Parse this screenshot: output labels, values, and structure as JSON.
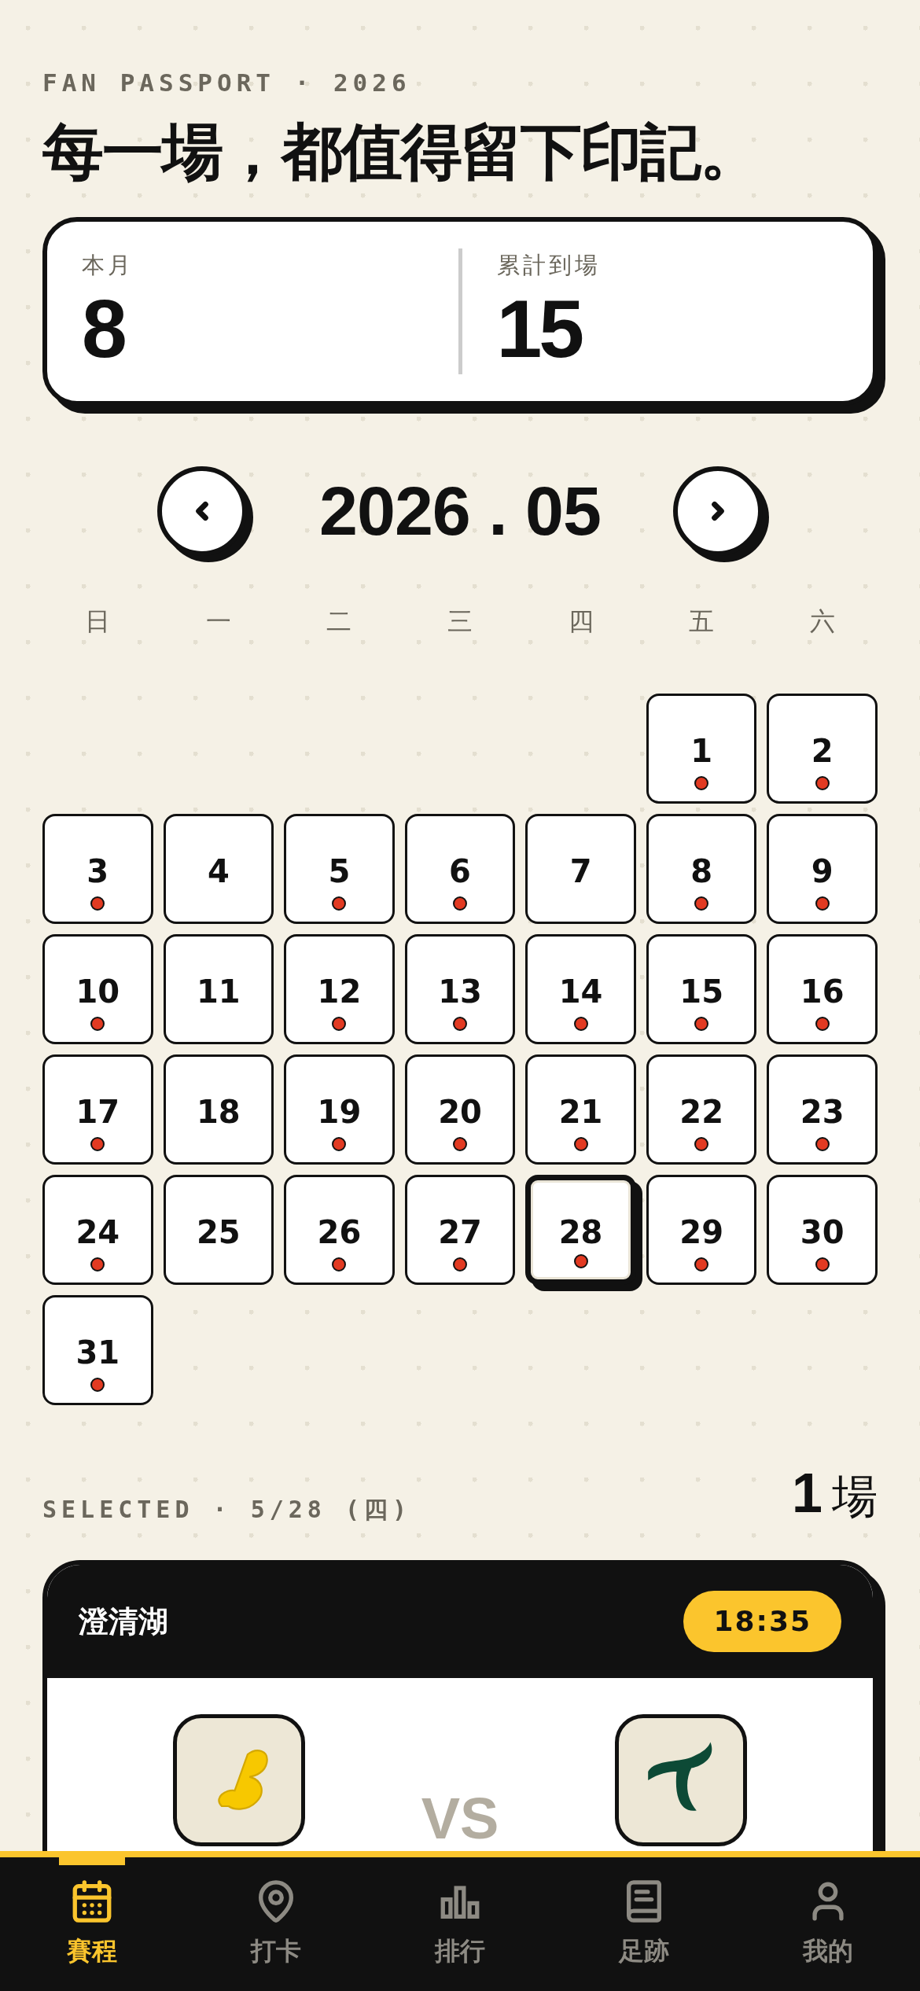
{
  "header": {
    "eyebrow": "FAN PASSPORT · 2026",
    "title": "每一場，都值得留下印記。"
  },
  "stats": [
    {
      "label": "本月",
      "value": "8"
    },
    {
      "label": "累計到場",
      "value": "15"
    }
  ],
  "month": "2026 . 05",
  "weekdays": [
    "日",
    "一",
    "二",
    "三",
    "四",
    "五",
    "六"
  ],
  "cells": [
    {
      "kind": "blank"
    },
    {
      "kind": "blank"
    },
    {
      "kind": "blank"
    },
    {
      "kind": "blank"
    },
    {
      "kind": "blank"
    },
    {
      "kind": "day",
      "label": "1",
      "has_game": true,
      "selected": false
    },
    {
      "kind": "day",
      "label": "2",
      "has_game": true,
      "selected": false
    },
    {
      "kind": "day",
      "label": "3",
      "has_game": true,
      "selected": false
    },
    {
      "kind": "day",
      "label": "4",
      "has_game": false,
      "selected": false
    },
    {
      "kind": "day",
      "label": "5",
      "has_game": true,
      "selected": false
    },
    {
      "kind": "day",
      "label": "6",
      "has_game": true,
      "selected": false
    },
    {
      "kind": "day",
      "label": "7",
      "has_game": false,
      "selected": false
    },
    {
      "kind": "day",
      "label": "8",
      "has_game": true,
      "selected": false
    },
    {
      "kind": "day",
      "label": "9",
      "has_game": true,
      "selected": false
    },
    {
      "kind": "day",
      "label": "10",
      "has_game": true,
      "selected": false
    },
    {
      "kind": "day",
      "label": "11",
      "has_game": false,
      "selected": false
    },
    {
      "kind": "day",
      "label": "12",
      "has_game": true,
      "selected": false
    },
    {
      "kind": "day",
      "label": "13",
      "has_game": true,
      "selected": false
    },
    {
      "kind": "day",
      "label": "14",
      "has_game": true,
      "selected": false
    },
    {
      "kind": "day",
      "label": "15",
      "has_game": true,
      "selected": false
    },
    {
      "kind": "day",
      "label": "16",
      "has_game": true,
      "selected": false
    },
    {
      "kind": "day",
      "label": "17",
      "has_game": true,
      "selected": false
    },
    {
      "kind": "day",
      "label": "18",
      "has_game": false,
      "selected": false
    },
    {
      "kind": "day",
      "label": "19",
      "has_game": true,
      "selected": false
    },
    {
      "kind": "day",
      "label": "20",
      "has_game": true,
      "selected": false
    },
    {
      "kind": "day",
      "label": "21",
      "has_game": true,
      "selected": false
    },
    {
      "kind": "day",
      "label": "22",
      "has_game": true,
      "selected": false
    },
    {
      "kind": "day",
      "label": "23",
      "has_game": true,
      "selected": false
    },
    {
      "kind": "day",
      "label": "24",
      "has_game": true,
      "selected": false
    },
    {
      "kind": "day",
      "label": "25",
      "has_game": false,
      "selected": false
    },
    {
      "kind": "day",
      "label": "26",
      "has_game": true,
      "selected": false
    },
    {
      "kind": "day",
      "label": "27",
      "has_game": true,
      "selected": false
    },
    {
      "kind": "day",
      "label": "28",
      "has_game": true,
      "selected": true
    },
    {
      "kind": "day",
      "label": "29",
      "has_game": true,
      "selected": false
    },
    {
      "kind": "day",
      "label": "30",
      "has_game": true,
      "selected": false
    },
    {
      "kind": "day",
      "label": "31",
      "has_game": true,
      "selected": false
    }
  ],
  "selection": {
    "label": "SELECTED · 5/28 (四)",
    "count": "1",
    "unit": "場"
  },
  "game": {
    "venue": "澄清湖",
    "time": "18:35",
    "vs": "VS"
  },
  "tabs": [
    {
      "label": "賽程",
      "selected": true
    },
    {
      "label": "打卡",
      "selected": false
    },
    {
      "label": "排行",
      "selected": false
    },
    {
      "label": "足跡",
      "selected": false
    },
    {
      "label": "我的",
      "selected": false
    }
  ]
}
